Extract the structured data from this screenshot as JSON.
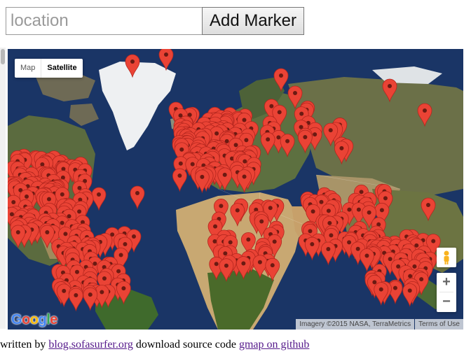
{
  "search": {
    "placeholder": "location",
    "value": ""
  },
  "toolbar": {
    "add_marker_label": "Add Marker"
  },
  "map": {
    "map_types": [
      {
        "label": "Map",
        "active": false
      },
      {
        "label": "Satellite",
        "active": true
      }
    ],
    "zoom_in_label": "+",
    "zoom_out_label": "−",
    "google_logo": "Google",
    "attribution": "Imagery ©2015 NASA, TerraMetrics",
    "terms_link": "Terms of Use",
    "marker_color": "#ea4335",
    "marker_dot_color": "#6b1a12",
    "ocean_color": "#1a3566",
    "icons": {
      "pegman": "pegman-icon",
      "marker": "map-marker-icon"
    }
  },
  "footer": {
    "text1": "written by",
    "link1": "blog.sofasurfer.org",
    "text2": "download source code",
    "link2": "gmap on github"
  }
}
